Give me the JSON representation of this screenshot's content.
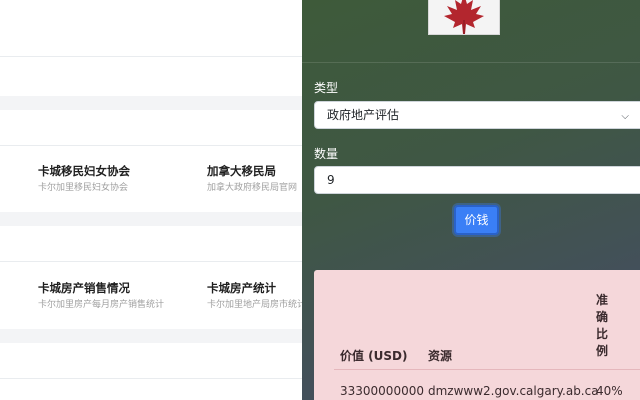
{
  "left_page": {
    "links": [
      {
        "title": "卡城移民妇女协会",
        "subtitle": "卡尔加里移民妇女协会"
      },
      {
        "title": "加拿大移民局",
        "subtitle": "加拿大政府移民局官网"
      },
      {
        "title": "卡城房产销售情况",
        "subtitle": "卡尔加里房产每月房产销售统计"
      },
      {
        "title": "卡城房产统计",
        "subtitle": "卡尔加里地产局房市统计"
      }
    ]
  },
  "panel": {
    "type_label": "类型",
    "type_selected": "政府地产评估",
    "quantity_label": "数量",
    "quantity_value": "9",
    "submit_label": "价钱",
    "table": {
      "headers": [
        "价值 (USD)",
        "资源",
        "准确比例"
      ],
      "accuracy_chars": [
        "准",
        "确",
        "比",
        "例"
      ],
      "rows": [
        {
          "value": "33300000000",
          "source": "dmzwww2.gov.calgary.ab.ca",
          "accuracy": "40%"
        }
      ]
    }
  },
  "colors": {
    "accent": "#3a7ff6",
    "result_bg": "#f5d7da",
    "maple_leaf": "#b3262e"
  },
  "icons": {
    "logo": "maple-leaf-icon",
    "dropdown": "chevron-down-icon"
  }
}
